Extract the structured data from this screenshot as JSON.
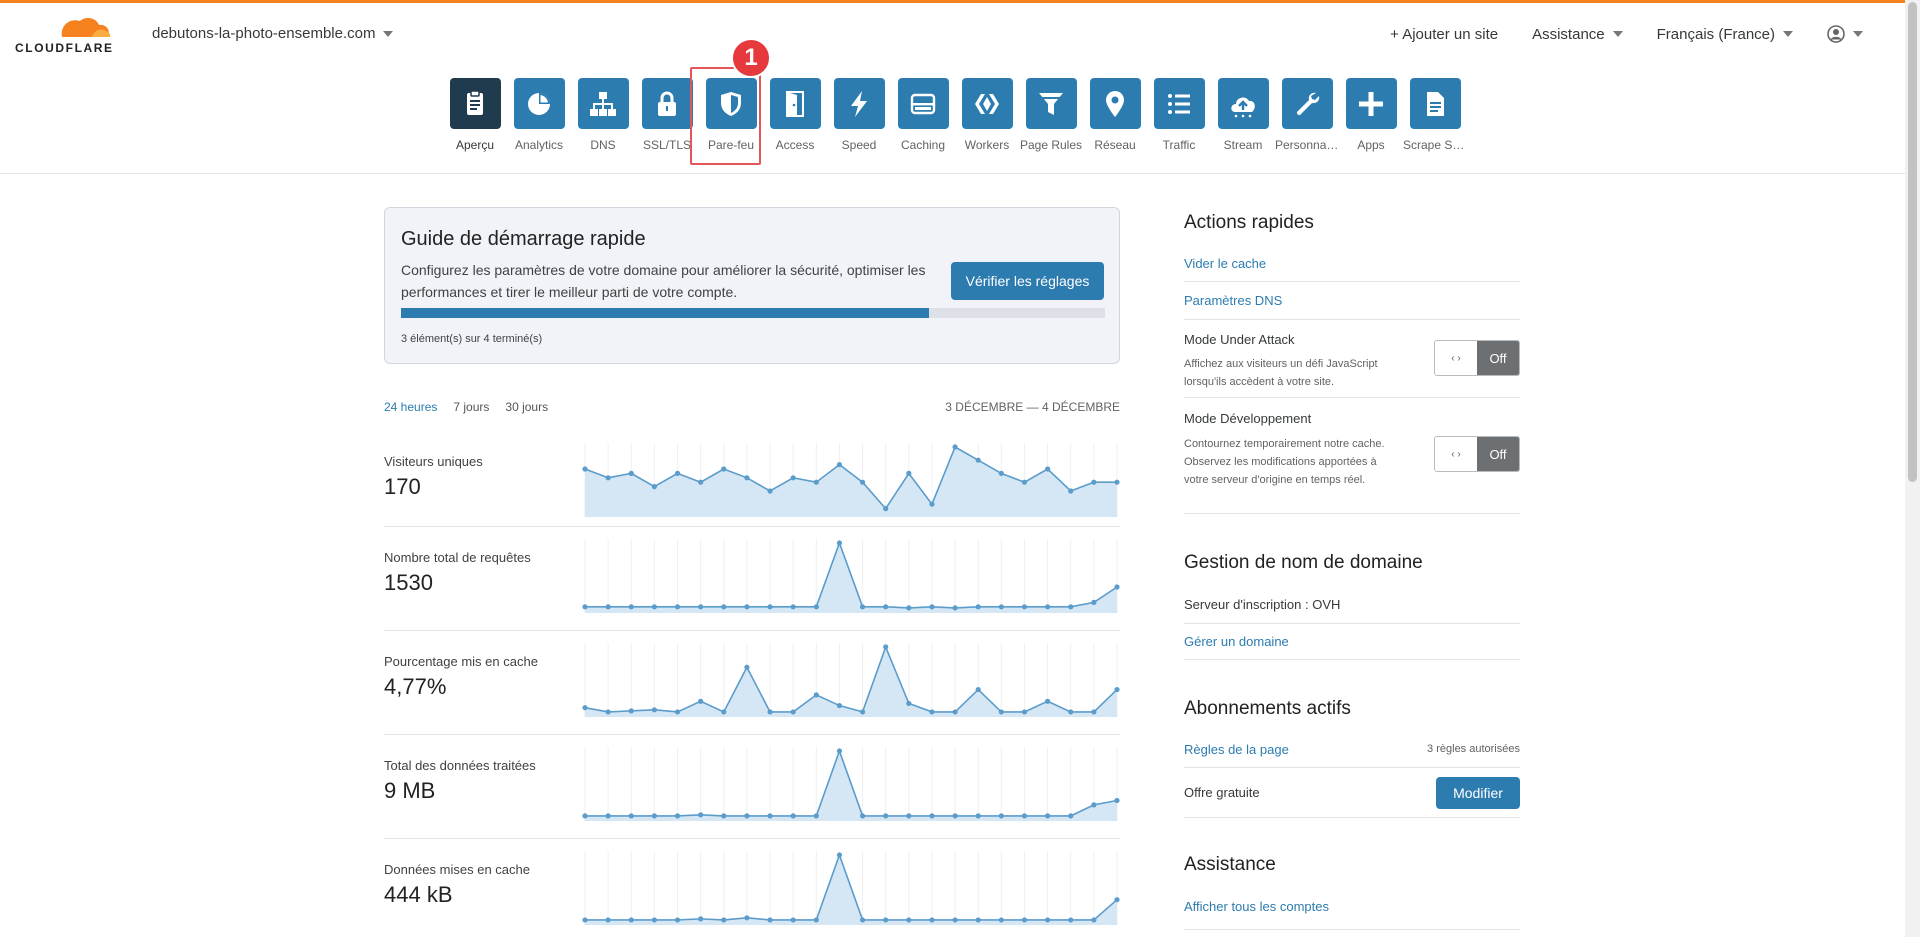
{
  "header": {
    "logo_text": "CLOUDFLARE",
    "domain": "debutons-la-photo-ensemble.com",
    "add_site": "+ Ajouter un site",
    "support": "Assistance",
    "language": "Français (France)"
  },
  "nav": {
    "items": [
      {
        "label": "Aperçu",
        "icon": "clipboard-icon",
        "active": true
      },
      {
        "label": "Analytics",
        "icon": "pie-chart-icon"
      },
      {
        "label": "DNS",
        "icon": "network-icon"
      },
      {
        "label": "SSL/TLS",
        "icon": "lock-icon"
      },
      {
        "label": "Pare-feu",
        "icon": "shield-icon"
      },
      {
        "label": "Access",
        "icon": "door-icon"
      },
      {
        "label": "Speed",
        "icon": "lightning-icon"
      },
      {
        "label": "Caching",
        "icon": "server-icon"
      },
      {
        "label": "Workers",
        "icon": "workers-icon"
      },
      {
        "label": "Page Rules",
        "icon": "filter-icon"
      },
      {
        "label": "Réseau",
        "icon": "map-pin-icon"
      },
      {
        "label": "Traffic",
        "icon": "list-icon"
      },
      {
        "label": "Stream",
        "icon": "cloud-upload-icon"
      },
      {
        "label": "Personnali...",
        "icon": "wrench-icon"
      },
      {
        "label": "Apps",
        "icon": "plus-icon"
      },
      {
        "label": "Scrape Shi...",
        "icon": "document-icon"
      }
    ],
    "step_badge": "1"
  },
  "guide": {
    "title": "Guide de démarrage rapide",
    "text": "Configurez les paramètres de votre domaine pour améliorer la sécurité, optimiser les performances et tirer le meilleur parti de votre compte.",
    "button": "Vérifier les réglages",
    "progress": 0.75,
    "status": "3 élément(s) sur 4 terminé(s)"
  },
  "analytics": {
    "tabs": [
      "24 heures",
      "7 jours",
      "30 jours"
    ],
    "date_range": "3 DÉCEMBRE — 4 DÉCEMBRE",
    "accent_color": "#5b9ccb",
    "fill_color": "#d5e7f5"
  },
  "chart_data": [
    {
      "type": "area",
      "title": "Visiteurs uniques",
      "value_label": "170",
      "values": [
        10,
        8,
        9,
        6,
        9,
        7,
        10,
        8,
        5,
        8,
        7,
        11,
        7,
        1,
        9,
        2,
        15,
        12,
        9,
        7,
        10,
        5,
        7,
        7
      ]
    },
    {
      "type": "area",
      "title": "Nombre total de requêtes",
      "value_label": "1530",
      "values": [
        2,
        2,
        2,
        2,
        2,
        2,
        2,
        2,
        2,
        2,
        2,
        60,
        2,
        2,
        1,
        2,
        1,
        2,
        2,
        2,
        2,
        2,
        6,
        20
      ]
    },
    {
      "type": "area",
      "title": "Pourcentage mis en cache",
      "value_label": "4,77%",
      "values": [
        5,
        1,
        2,
        3,
        1,
        11,
        1,
        43,
        1,
        1,
        17,
        7,
        1,
        62,
        9,
        1,
        1,
        22,
        1,
        1,
        11,
        1,
        1,
        22
      ]
    },
    {
      "type": "area",
      "title": "Total des données traitées",
      "value_label": "9 MB",
      "values": [
        1,
        1,
        1,
        1,
        1,
        2,
        1,
        1,
        1,
        1,
        1,
        60,
        1,
        1,
        1,
        1,
        1,
        1,
        1,
        1,
        1,
        1,
        11,
        15
      ]
    },
    {
      "type": "area",
      "title": "Données mises en cache",
      "value_label": "444 kB",
      "values": [
        1,
        1,
        1,
        1,
        1,
        2,
        1,
        3,
        1,
        1,
        1,
        62,
        1,
        1,
        1,
        1,
        1,
        1,
        1,
        1,
        1,
        1,
        1,
        20
      ]
    }
  ],
  "sidebar": {
    "quick_actions": {
      "title": "Actions rapides",
      "purge_cache": "Vider le cache",
      "dns_settings": "Paramètres DNS",
      "under_attack": {
        "title": "Mode Under Attack",
        "desc": "Affichez aux visiteurs un défi JavaScript lorsqu'ils accèdent à votre site.",
        "state": "Off"
      },
      "dev_mode": {
        "title": "Mode Développement",
        "desc": "Contournez temporairement notre cache. Observez les modifications apportées à votre serveur d'origine en temps réel.",
        "state": "Off"
      }
    },
    "domain_mgmt": {
      "title": "Gestion de nom de domaine",
      "registrar": "Serveur d'inscription : OVH",
      "manage": "Gérer un domaine"
    },
    "subscriptions": {
      "title": "Abonnements actifs",
      "page_rules": "Règles de la page",
      "page_rules_note": "3 règles autorisées",
      "plan": "Offre gratuite",
      "modify": "Modifier"
    },
    "support": {
      "title": "Assistance",
      "all_accounts": "Afficher tous les comptes"
    }
  }
}
